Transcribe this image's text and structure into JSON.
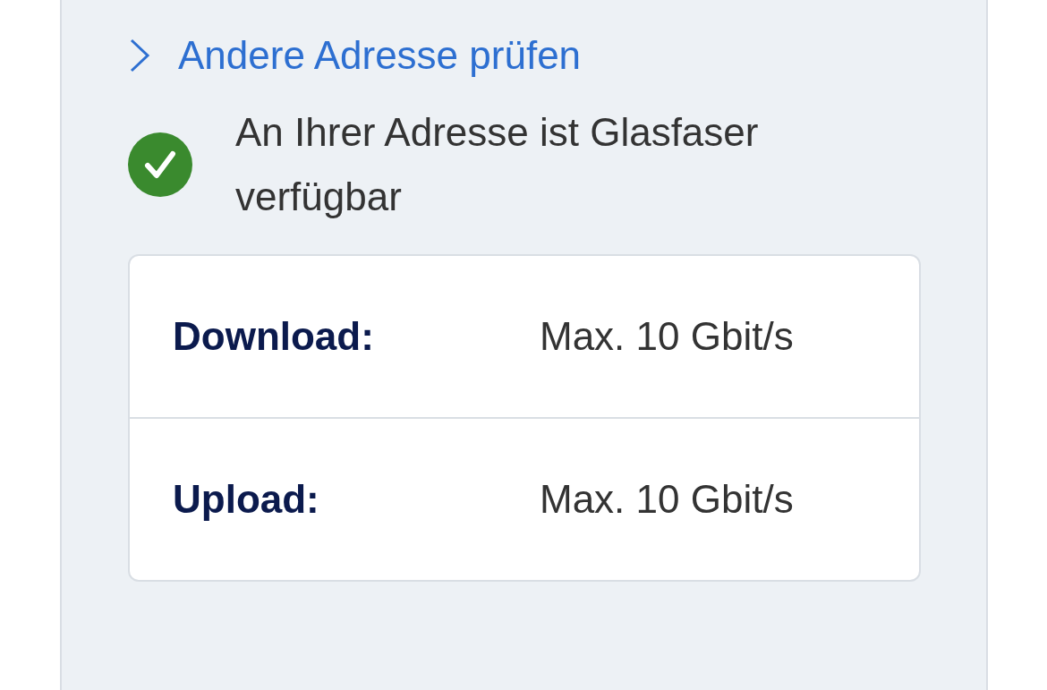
{
  "link": {
    "label": "Andere Adresse prüfen"
  },
  "status": {
    "ok": true,
    "text": "An Ihrer Adresse ist Glasfaser verfügbar"
  },
  "speeds": [
    {
      "label": "Download:",
      "value": "Max. 10 Gbit/s"
    },
    {
      "label": "Upload:",
      "value": "Max. 10 Gbit/s"
    }
  ]
}
